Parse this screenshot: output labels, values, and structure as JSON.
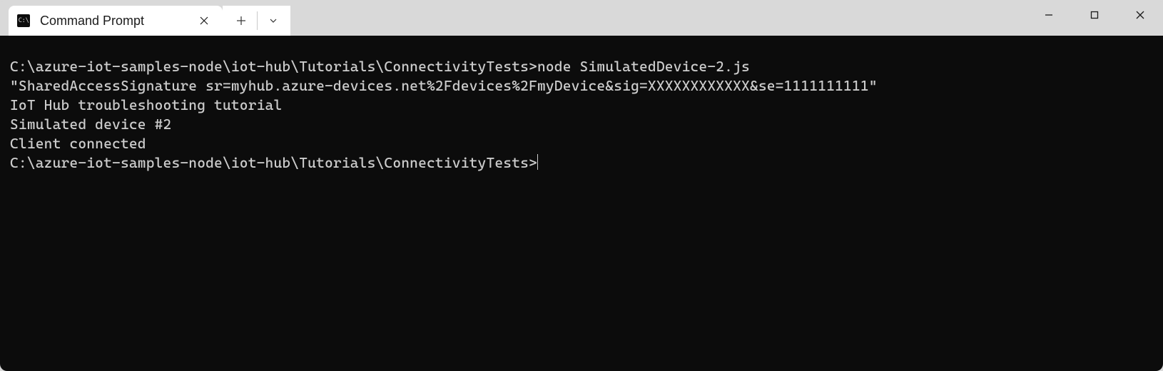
{
  "tab": {
    "title": "Command Prompt",
    "icon_glyph": "C:\\"
  },
  "terminal": {
    "lines": [
      {
        "type": "prompt",
        "prompt": "C:\\azure-iot-samples-node\\iot-hub\\Tutorials\\ConnectivityTests>",
        "command": "node SimulatedDevice-2.js"
      },
      {
        "type": "output",
        "text": "\"SharedAccessSignature sr=myhub.azure-devices.net%2Fdevices%2FmyDevice&sig=XXXXXXXXXXXX&se=1111111111\""
      },
      {
        "type": "output",
        "text": "IoT Hub troubleshooting tutorial"
      },
      {
        "type": "output",
        "text": "Simulated device #2"
      },
      {
        "type": "output",
        "text": ""
      },
      {
        "type": "output",
        "text": "Client connected"
      },
      {
        "type": "output",
        "text": ""
      },
      {
        "type": "prompt",
        "prompt": "C:\\azure-iot-samples-node\\iot-hub\\Tutorials\\ConnectivityTests>",
        "command": "",
        "cursor": true
      }
    ]
  }
}
